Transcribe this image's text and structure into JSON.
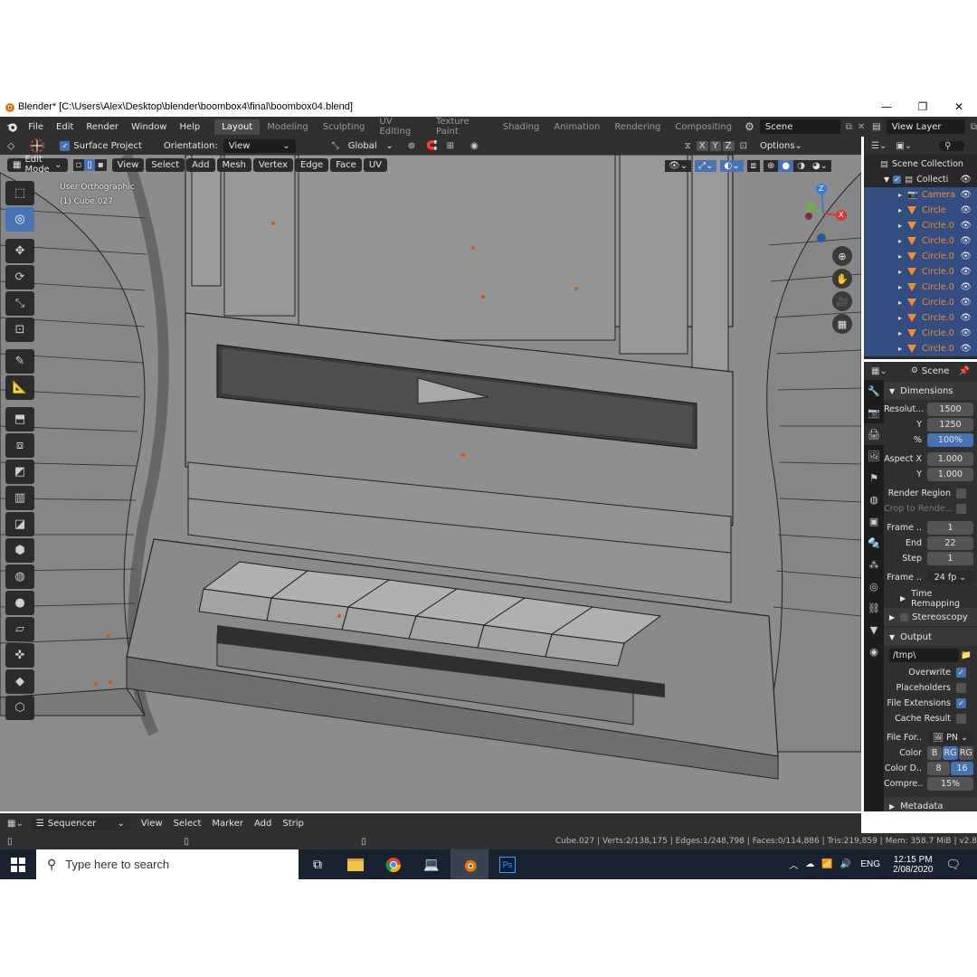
{
  "window": {
    "title": "Blender* [C:\\Users\\Alex\\Desktop\\blender\\boombox4\\final\\boombox04.blend]",
    "minimize": "—",
    "maximize": "❐",
    "close": "✕"
  },
  "topbar": {
    "menus": [
      "File",
      "Edit",
      "Render",
      "Window",
      "Help"
    ],
    "workspaces": [
      "Layout",
      "Modeling",
      "Sculpting",
      "UV Editing",
      "Texture Paint",
      "Shading",
      "Animation",
      "Rendering",
      "Compositing"
    ],
    "active_workspace": "Layout",
    "scene": "Scene",
    "view_layer": "View Layer"
  },
  "viewport_header": {
    "surface_project": "Surface Project",
    "orientation_label": "Orientation:",
    "orientation_value": "View",
    "transform_orientation": "Global",
    "axes": [
      "X",
      "Y",
      "Z"
    ],
    "options": "Options"
  },
  "viewport_menu": {
    "mode": "Edit Mode",
    "items": [
      "View",
      "Select",
      "Add",
      "Mesh",
      "Vertex",
      "Edge",
      "Face",
      "UV"
    ]
  },
  "viewport_overlay": {
    "view_name": "User Orthographic",
    "object_name": "(1) Cube.027"
  },
  "gizmo": {
    "x": "X",
    "y": "Y",
    "z": "Z"
  },
  "outliner": {
    "title": "Scene Collection",
    "rows": [
      {
        "name": "Scene Collectio",
        "type": "scene"
      },
      {
        "name": "Collecti",
        "type": "collection"
      },
      {
        "name": "Camera",
        "type": "camera"
      },
      {
        "name": "Circle",
        "type": "mesh"
      },
      {
        "name": "Circle.0",
        "type": "mesh"
      },
      {
        "name": "Circle.0",
        "type": "mesh"
      },
      {
        "name": "Circle.0",
        "type": "mesh"
      },
      {
        "name": "Circle.0",
        "type": "mesh"
      },
      {
        "name": "Circle.0",
        "type": "mesh"
      },
      {
        "name": "Circle.0",
        "type": "mesh"
      },
      {
        "name": "Circle.0",
        "type": "mesh"
      },
      {
        "name": "Circle.0",
        "type": "mesh"
      },
      {
        "name": "Circle.0",
        "type": "mesh"
      }
    ]
  },
  "properties": {
    "scene": "Scene",
    "dimensions": {
      "title": "Dimensions",
      "resolution_x_label": "Resolut...",
      "resolution_x": "1500",
      "resolution_y_label": "Y",
      "resolution_y": "1250",
      "resolution_pct_label": "%",
      "resolution_pct": "100%",
      "aspect_x_label": "Aspect X",
      "aspect_x": "1.000",
      "aspect_y_label": "Y",
      "aspect_y": "1.000",
      "render_region": "Render Region",
      "crop": "Crop to Rende...",
      "frame_start_label": "Frame ..",
      "frame_start": "1",
      "end_label": "End",
      "end": "22",
      "step_label": "Step",
      "step": "1",
      "frame_rate_label": "Frame ..",
      "frame_rate": "24 fp"
    },
    "time_remapping": "Time Remapping",
    "stereoscopy": "Stereoscopy",
    "output": {
      "title": "Output",
      "path": "/tmp\\",
      "overwrite": "Overwrite",
      "placeholders": "Placeholders",
      "file_extensions": "File Extensions",
      "cache_result": "Cache Result",
      "file_format_label": "File For..",
      "file_format": "PN",
      "color_label": "Color",
      "color_options": [
        "B",
        "RG",
        "RG"
      ],
      "color_depth_label": "Color D..",
      "color_depth_options": [
        "8",
        "16"
      ],
      "compression_label": "Compre..",
      "compression": "15%"
    },
    "metadata": "Metadata"
  },
  "sequencer": {
    "editor": "Sequencer",
    "menus": [
      "View",
      "Select",
      "Marker",
      "Add",
      "Strip"
    ]
  },
  "statusbar": {
    "text": "Cube.027 | Verts:2/138,175 | Edges:1/248,798 | Faces:0/114,886 | Tris:219,859 | Mem: 358.7 MiB | v2.8"
  },
  "taskbar": {
    "search_placeholder": "Type here to search",
    "language": "ENG",
    "time": "12:15 PM",
    "date": "2/08/2020"
  },
  "colors": {
    "blender_bg": "#303030",
    "accent_blue": "#4772b3",
    "object_orange": "#f08d35",
    "viewport_gray": "#8e8e8e"
  }
}
